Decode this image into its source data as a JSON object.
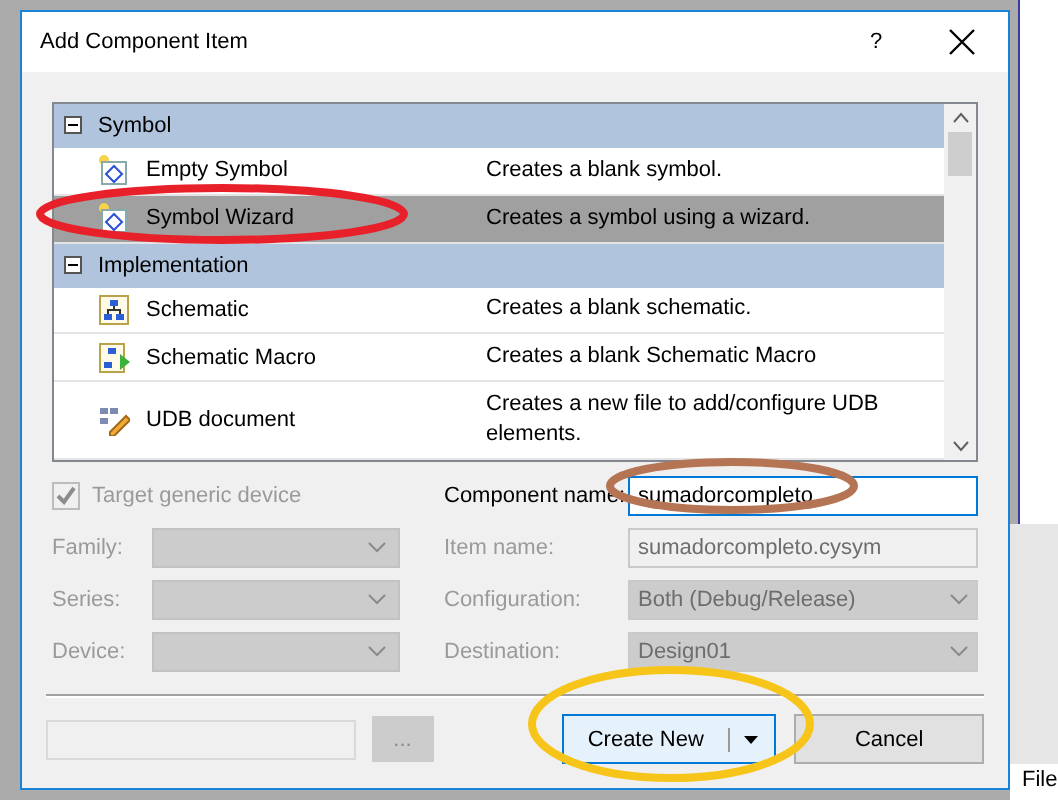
{
  "window": {
    "title": "Add Component Item",
    "help": "?"
  },
  "list": {
    "groups": [
      {
        "label": "Symbol",
        "expanded": true,
        "items": [
          {
            "name": "Empty Symbol",
            "description": "Creates a blank symbol.",
            "kind": "symbol",
            "selected": false
          },
          {
            "name": "Symbol Wizard",
            "description": "Creates a symbol using a wizard.",
            "kind": "symbol",
            "selected": true
          }
        ]
      },
      {
        "label": "Implementation",
        "expanded": true,
        "items": [
          {
            "name": "Schematic",
            "description": "Creates a blank schematic.",
            "kind": "schematic",
            "selected": false
          },
          {
            "name": "Schematic Macro",
            "description": "Creates a blank Schematic Macro",
            "kind": "macro",
            "selected": false
          },
          {
            "name": "UDB document",
            "description": "Creates a new file to add/configure UDB elements.",
            "kind": "udb",
            "selected": false
          }
        ]
      }
    ]
  },
  "target_generic_device": {
    "label": "Target generic device",
    "checked": true,
    "disabled": true
  },
  "device_fields": [
    {
      "label": "Family:"
    },
    {
      "label": "Series:"
    },
    {
      "label": "Device:"
    }
  ],
  "item_fields": [
    {
      "label": "Component name:",
      "value": "sumadorcompleto",
      "kind": "input"
    },
    {
      "label": "Item name:",
      "value": "sumadorcompleto.cysym",
      "kind": "readonly"
    },
    {
      "label": "Configuration:",
      "value": "Both (Debug/Release)",
      "kind": "dropdown"
    },
    {
      "label": "Destination:",
      "value": "Design01",
      "kind": "dropdown"
    }
  ],
  "footer": {
    "browse": "...",
    "create": "Create New",
    "cancel": "Cancel"
  },
  "background": {
    "menu_text": "File"
  },
  "annotations": [
    {
      "color": "#e8202a"
    },
    {
      "color": "#b57555"
    },
    {
      "color": "#f7c51a"
    }
  ]
}
